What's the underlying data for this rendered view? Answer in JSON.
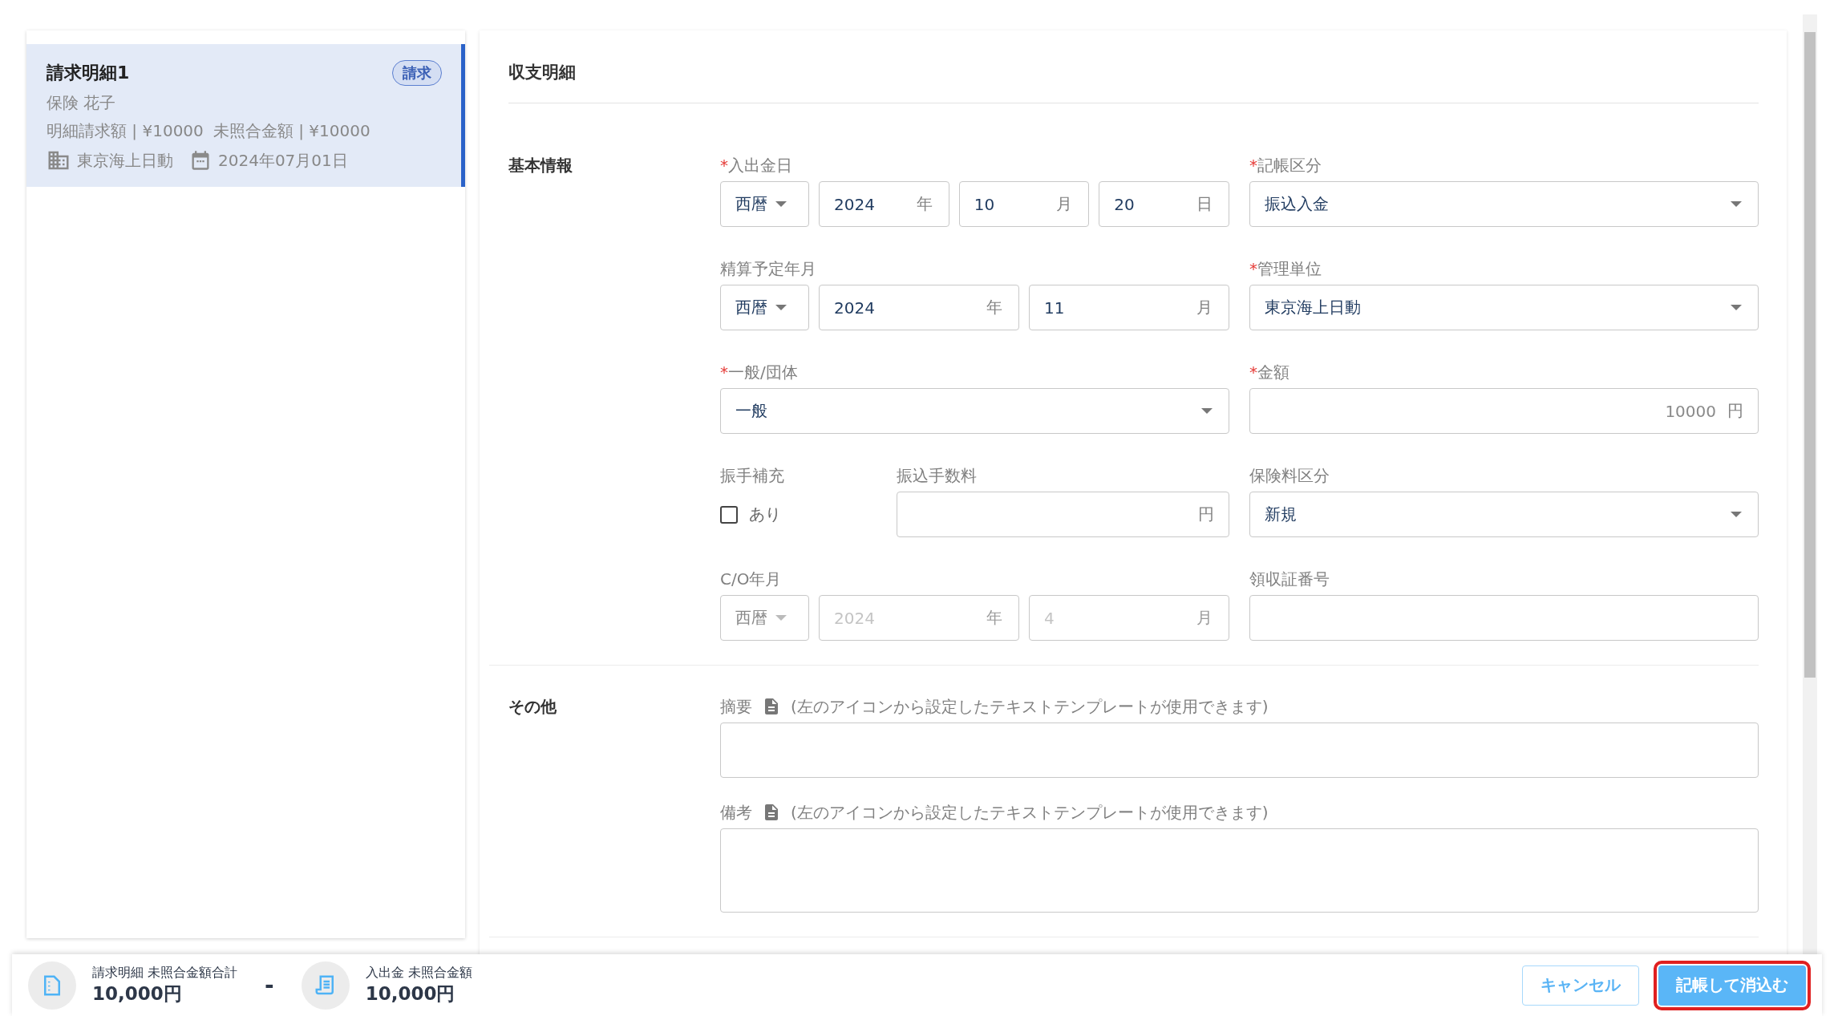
{
  "sidebar": {
    "items": [
      {
        "title": "請求明細1",
        "badge": "請求",
        "selected": true,
        "name": "保険 花子",
        "amount_lines": [
          "明細請求額 | ¥10000",
          "未照合金額 | ¥10000"
        ],
        "company": "東京海上日動",
        "date": "2024年07月01日"
      }
    ]
  },
  "panel": {
    "title": "収支明細",
    "required_mark": "*",
    "sections": [
      {
        "kind": "fields",
        "label": "基本情報",
        "fields": [
          {
            "kind": "date",
            "label": "入出金日",
            "required": true,
            "disabled": false,
            "era": "西暦",
            "parts": [
              {
                "value": "2024",
                "unit": "年"
              },
              {
                "value": "10",
                "unit": "月"
              },
              {
                "value": "20",
                "unit": "日"
              }
            ]
          },
          {
            "kind": "select",
            "label": "記帳区分",
            "required": true,
            "value": "振込入金"
          },
          {
            "kind": "date",
            "label": "精算予定年月",
            "required": false,
            "disabled": false,
            "era": "西暦",
            "parts": [
              {
                "value": "2024",
                "unit": "年"
              },
              {
                "value": "11",
                "unit": "月"
              }
            ]
          },
          {
            "kind": "select",
            "label": "管理単位",
            "required": true,
            "value": "東京海上日動"
          },
          {
            "kind": "select",
            "label": "一般/団体",
            "required": true,
            "value": "一般"
          },
          {
            "kind": "unit",
            "label": "金額",
            "required": true,
            "value": "10000",
            "unit": "円"
          },
          {
            "kind": "pair",
            "fields": [
              {
                "kind": "checkbox",
                "label": "振手補充",
                "required": false,
                "option": "あり",
                "checked": false
              },
              {
                "kind": "unit",
                "label": "振込手数料",
                "required": false,
                "unit": "円"
              }
            ]
          },
          {
            "kind": "select",
            "label": "保険料区分",
            "required": false,
            "value": "新規"
          },
          {
            "kind": "date",
            "label": "C/O年月",
            "required": false,
            "disabled": true,
            "era": "西暦",
            "parts": [
              {
                "placeholder": "2024",
                "unit": "年"
              },
              {
                "placeholder": "4",
                "unit": "月"
              }
            ]
          },
          {
            "kind": "text",
            "label": "領収証番号",
            "required": false
          }
        ]
      },
      {
        "kind": "notes",
        "label": "その他",
        "notes": [
          {
            "label": "摘要",
            "hint": "(左のアイコンから設定したテキストテンプレートが使用できます)"
          },
          {
            "label": "備考",
            "hint": "(左のアイコンから設定したテキストテンプレートが使用できます)"
          }
        ]
      }
    ]
  },
  "summary": {
    "operator": "-",
    "items": [
      {
        "kind": "invoice",
        "label": "請求明細 未照合金額合計",
        "amount": "10,000円"
      },
      {
        "kind": "receipt",
        "label": "入出金 未照合金額",
        "amount": "10,000円"
      }
    ]
  },
  "buttons": [
    {
      "label": "キャンセル",
      "kind": "secondary",
      "highlighted": false
    },
    {
      "label": "記帳して消込む",
      "kind": "primary",
      "highlighted": true
    }
  ]
}
